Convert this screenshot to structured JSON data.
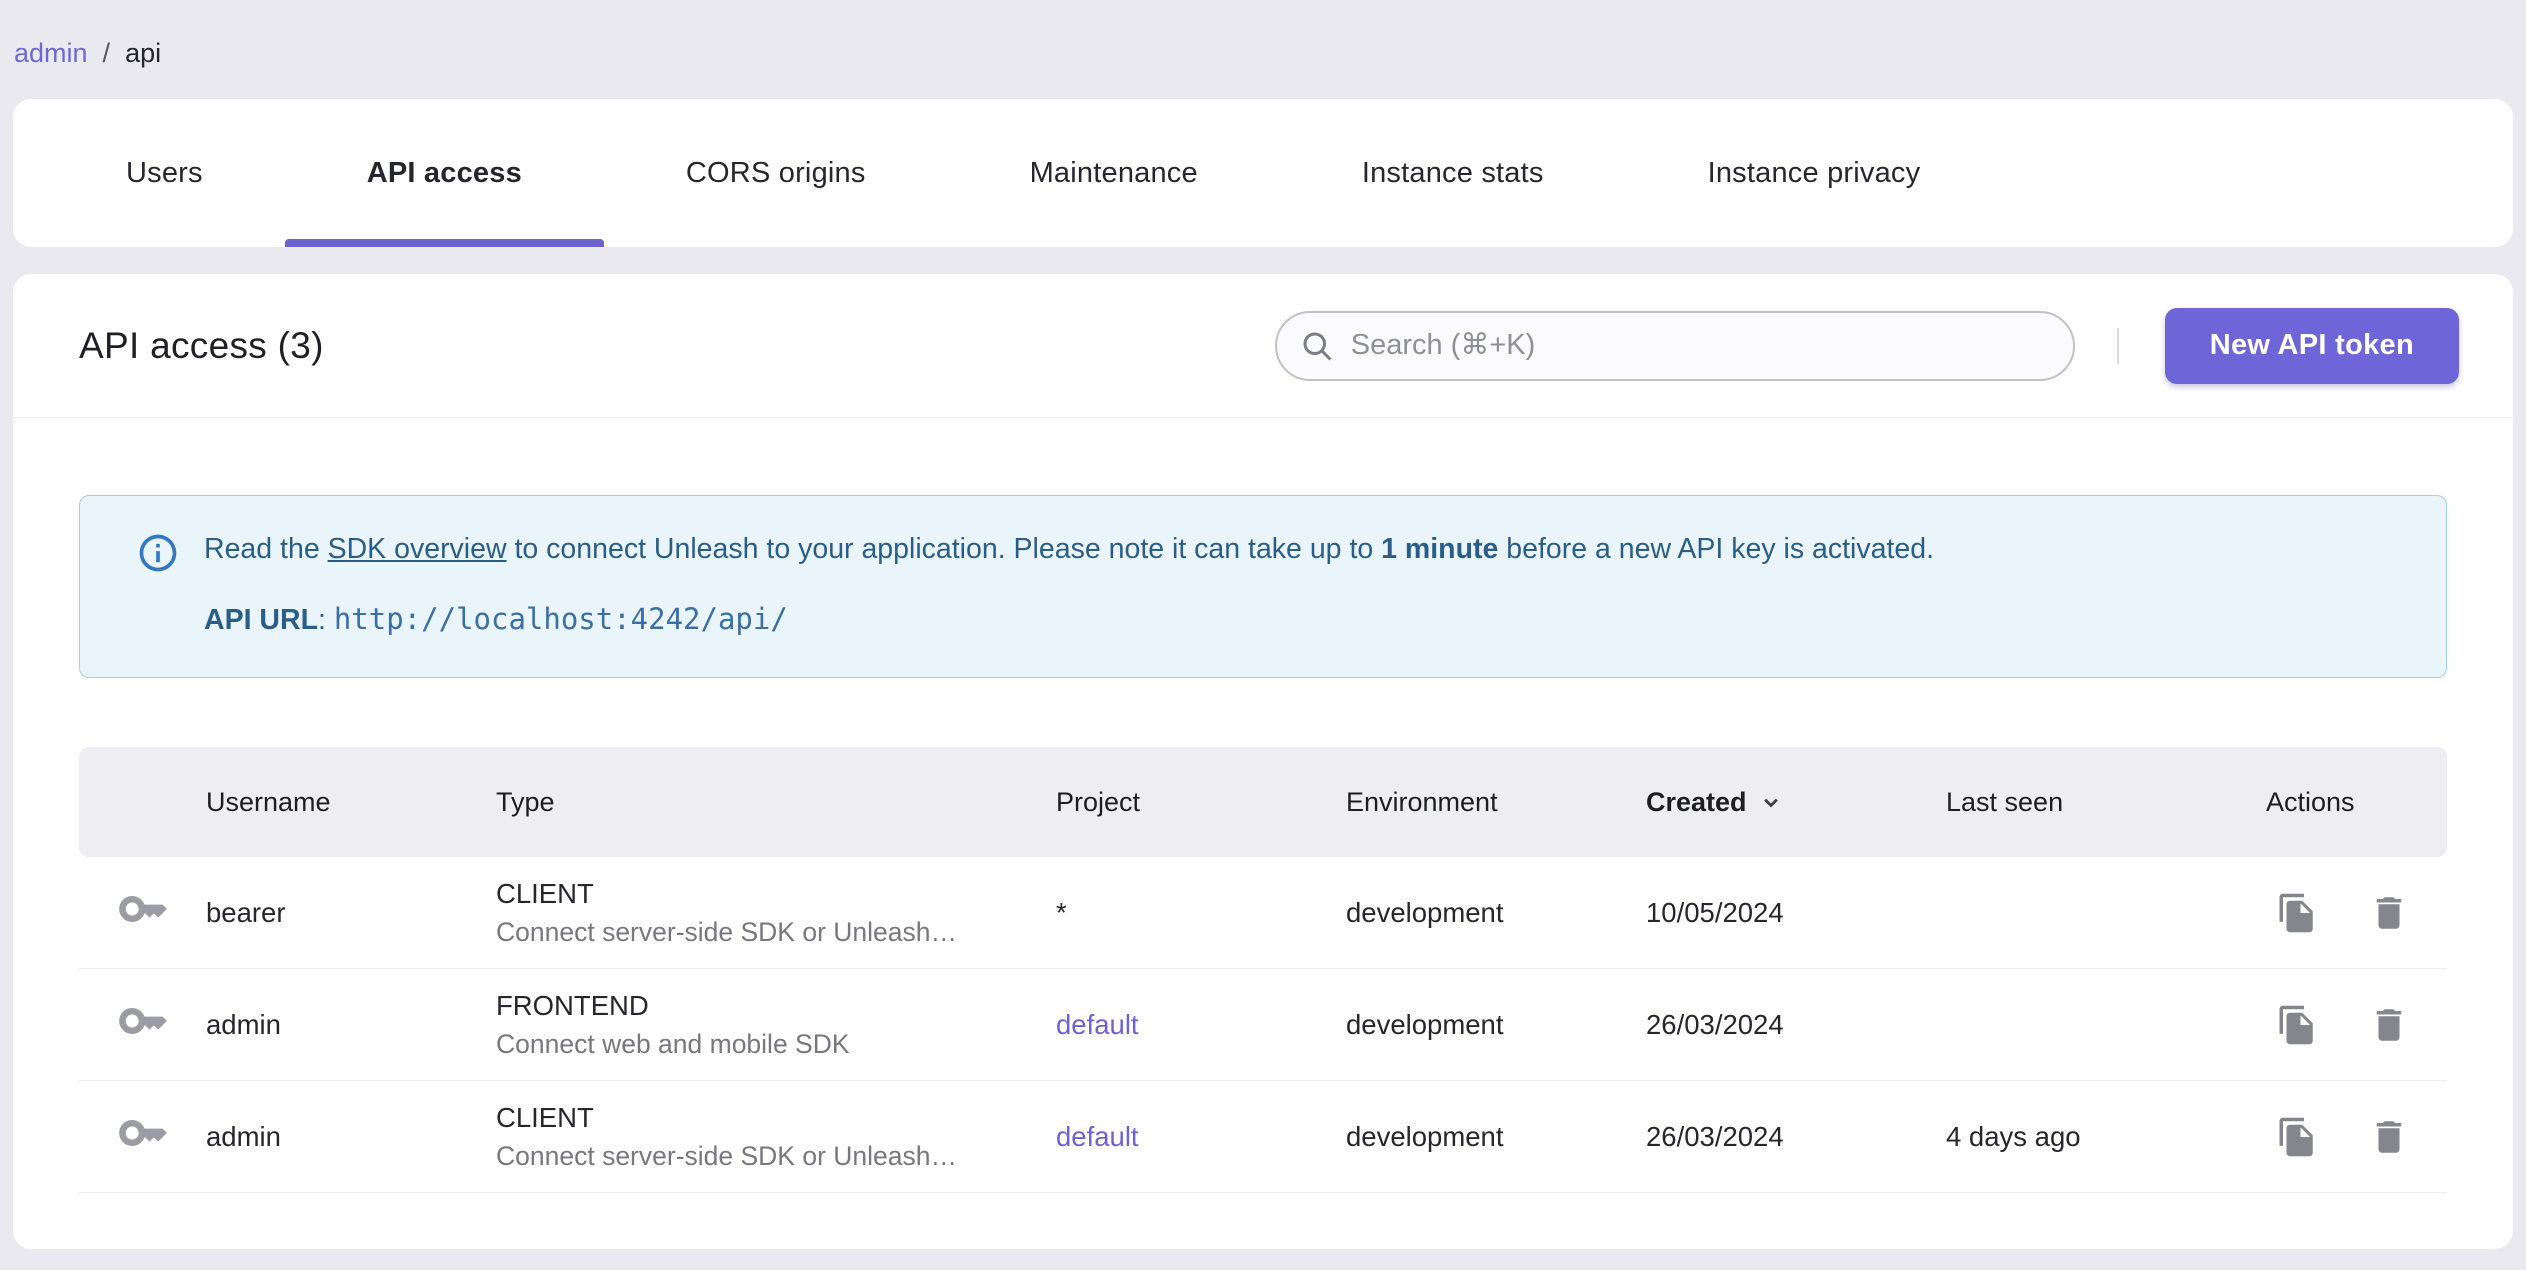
{
  "colors": {
    "accent": "#6C63D0",
    "accent_strong": "#6E66D8",
    "accent_light": "#7168CE",
    "page_bg": "#EAE9EF",
    "banner_bg": "#E9F4FB",
    "banner_border": "#A5CDEA",
    "banner_text": "#2A5E86",
    "thead_bg": "#EDEDF2",
    "info_icon": "#3077C5"
  },
  "icons": {
    "search": "magnifier",
    "info": "info-circle",
    "key": "key",
    "copy": "file-copy",
    "delete": "trash",
    "sort": "chevron-down"
  },
  "breadcrumb": {
    "link": "admin",
    "separator": "/",
    "current": "api"
  },
  "tabs": [
    {
      "label": "Users",
      "active": false
    },
    {
      "label": "API access",
      "active": true
    },
    {
      "label": "CORS origins",
      "active": false
    },
    {
      "label": "Maintenance",
      "active": false
    },
    {
      "label": "Instance stats",
      "active": false
    },
    {
      "label": "Instance privacy",
      "active": false
    }
  ],
  "header": {
    "title": "API access (3)",
    "search_placeholder": "Search (⌘+K)",
    "new_token_button": "New API token"
  },
  "banner": {
    "text_prefix": "Read the ",
    "link_text": "SDK overview",
    "text_middle": " to connect Unleash to your application. Please note it can take up to ",
    "text_bold": "1 minute",
    "text_suffix": " before a new API key is activated.",
    "api_url_label": "API URL",
    "api_url_separator": ": ",
    "api_url": "http://localhost:4242/api/"
  },
  "table": {
    "sort": {
      "column": "Created",
      "direction": "desc"
    },
    "columns": {
      "username": "Username",
      "type": "Type",
      "project": "Project",
      "environment": "Environment",
      "created": "Created",
      "last_seen": "Last seen",
      "actions": "Actions"
    },
    "rows": [
      {
        "username": "bearer",
        "type": "CLIENT",
        "type_description": "Connect server-side SDK or Unleash…",
        "project": "*",
        "project_is_link": false,
        "environment": "development",
        "created": "10/05/2024",
        "last_seen": ""
      },
      {
        "username": "admin",
        "type": "FRONTEND",
        "type_description": "Connect web and mobile SDK",
        "project": "default",
        "project_is_link": true,
        "environment": "development",
        "created": "26/03/2024",
        "last_seen": ""
      },
      {
        "username": "admin",
        "type": "CLIENT",
        "type_description": "Connect server-side SDK or Unleash…",
        "project": "default",
        "project_is_link": true,
        "environment": "development",
        "created": "26/03/2024",
        "last_seen": "4 days ago"
      }
    ]
  }
}
